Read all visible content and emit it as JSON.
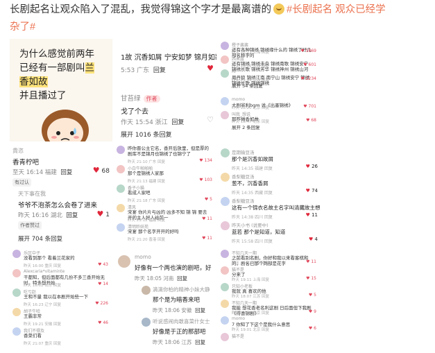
{
  "post": {
    "text_before": "长剧起名让观众陷入了混乱，我觉得锦这个字才是最离谱的",
    "tag1": "#长剧起名 观众已经学",
    "tag2": "杂了#",
    "emoji": "doge-emoji"
  },
  "cell1": {
    "line1": "为什么感觉前两年",
    "line2": "已经有一部剧叫",
    "line2_hl": "兰",
    "line3": "香如故",
    "line4": "并且播过了"
  },
  "cell2": {
    "titles": "1故 沉香如屑 宁安如梦 锦月如歌",
    "time1": "5:53 广东",
    "reply1": "回复",
    "user": "甘苔绿",
    "badge": "作者",
    "comment": "戈了个去",
    "meta": "作天 15:54 浙江",
    "reply2": "回复",
    "expand": "展开 1016 条回复"
  },
  "cell3": {
    "rows": [
      {
        "name": "橙子酱酱",
        "text": "还有各种锦绣 锦绣缘什么的 锦绣了好几部名称字的",
        "meta": "昨天 17:23 上海 回复",
        "likes": "1869"
      },
      {
        "name": "西米露",
        "text": "还有锦绣 锦绣未央 锦绣南歌 锦绣安宁 锦绣长歌 锦绣芳华 锦绣神州 锦绣山河",
        "meta": "昨天 18:02 江苏 回复",
        "likes": "601"
      },
      {
        "name": "Rr",
        "text": "周丹狼 锦绣江南 南宁山 锦绣安宁 锦绣 锦绣长歌 锦绣锦绣",
        "meta": "昨天 21:44 江苏 回复",
        "likes": "2234"
      },
      {
        "name": "",
        "text": "展开 54 条回复",
        "meta": "",
        "likes": ""
      },
      {
        "name": "momo",
        "text": "大剧爷利bgm 说《出墨锦绣》",
        "meta": "昨天 18:20 北京 回复",
        "likes": "701"
      },
      {
        "name": "叫我_想说",
        "text": "那咋摊香如故",
        "meta": "昨天 18:47 北京 回复",
        "likes": "68"
      },
      {
        "name": "",
        "text": "展开 2 条回复",
        "meta": "",
        "likes": ""
      }
    ]
  },
  "cell4": {
    "user1": "貴恣",
    "comment1": "香青柠吧",
    "meta1": "至天 16:14 福建",
    "reply1": "回复",
    "likes1": "68",
    "chip1": "有过认",
    "user2": "天下事在我",
    "comment2": "爷爷不泡茶怎么会卷了进来",
    "meta2": "昨天 16:16 湖北",
    "reply2": "回复",
    "likes2": "1",
    "chip2": "作者赞过",
    "expand": "展开 704 条回复"
  },
  "cell5": {
    "rows": [
      {
        "name": "",
        "text": "昨你晋公主它名，香开后放里，但是厚的剧库不是锦月也锦绣了也锦宁了",
        "meta": "昨天 21:10 广东 回复",
        "likes": "134"
      },
      {
        "name": "小白牛啪啪啪",
        "text": "那个是锦绣人家那",
        "meta": "昨天 21:13 福建 回复",
        "likes": "103"
      },
      {
        "name": "香子小猫",
        "text": "看成人家吧",
        "meta": "昨天 21:18 广东 回复",
        "likes": "5"
      },
      {
        "name": "清风",
        "text": "宋宴 你片片与凶的 凶多不知 锦 锦 要去开的主人好人给前一",
        "meta": "昨天 21:12 福建 回复",
        "likes": "11"
      },
      {
        "name": "清明聆妖苑",
        "text": "宋宴 那个名字开开的好吗",
        "meta": "昨天 21:20 香港 回复",
        "likes": "11"
      }
    ]
  },
  "cell6": {
    "rows": [
      {
        "name": "是期输豆汤",
        "text": "那个是沉香如故屑",
        "meta": "昨天 14:35 福建 回复",
        "likes": "26"
      },
      {
        "name": "香梨糖豆汤",
        "text": "葱不，沉香香屑",
        "meta": "昨天 14:35 西藏 回复",
        "likes": "74"
      },
      {
        "name": "香梨糖豆汤",
        "text": "这有一个锦衣名故主名字叫清藏故主想是名字",
        "meta": "昨天 14:38 四川 回复",
        "likes": "11"
      },
      {
        "name": "昨天小书 (说要中)",
        "text": "蓝若 那个是知道，知道",
        "meta": "昨天 15:58 四川 回复",
        "likes": "4"
      }
    ]
  },
  "cell7": {
    "rows": [
      {
        "name": "乐区中子",
        "text": "没看到那个 看着兰花家的",
        "meta": "昨天 16:00 重庆 回复",
        "likes": "43"
      },
      {
        "name": "Alexcaria*vitaminte",
        "text": "干都知，但后面都有几份不多三香开始无时，特多想开始",
        "meta": "昨天 16:02 山东 回复",
        "likes": "14"
      },
      {
        "name": "吃亏赵",
        "text": "王和不量 我以在本剧开始些一下",
        "meta": "昨天 16:23 辽宁 回复",
        "likes": "226"
      },
      {
        "name": "胡子牛哈",
        "text": "王霸非常",
        "meta": "昨天 19:21 安徽 回复",
        "likes": "46"
      },
      {
        "name": "我们不得及",
        "text": "香菜们看",
        "meta": "昨天 21:07 重庆 回复",
        "likes": ""
      }
    ]
  },
  "cell8": {
    "user1": "momo",
    "comment1": "好像有一个两也演的剧吧，好",
    "meta1": "昨天 18:05 河南",
    "reply1": "回复",
    "user2": "滴滴你柏的精神小妹大静",
    "comment2": "那个是为暗香来吧",
    "meta2": "昨天 18:06 安徽",
    "reply2": "回复",
    "user3": "听说感闹肉敢喜菜什女士",
    "comment3": "好像是于正的那部吧",
    "meta3": "昨天 18:06 江苏",
    "reply3": "回复"
  },
  "cell9": {
    "rows": [
      {
        "name": "不知几天一期",
        "text": "之前看别名剧，你好和我以来看客棋和的，剧名已那个两部是花字",
        "meta": "昨天 17:52 北京 回复",
        "likes": "11"
      },
      {
        "name": "猫不是",
        "text": "分来了",
        "meta": "昨天 19:11 上海 回复",
        "likes": "15"
      },
      {
        "name": "只知小老板",
        "text": "我就 真 喜欢的他",
        "meta": "昨天 18:07 江苏 回复",
        "likes": "5"
      },
      {
        "name": "不知几天一期",
        "text": "我能 想花香老名利这剧 日后面但下我剧《得喜锦剧》",
        "meta": "昨天 18:59 北京 回复",
        "likes": "9"
      },
      {
        "name": "momo",
        "text": "7 你知了下这个是我什么意思",
        "meta": "昨天 19:01 北京 回复",
        "likes": "6"
      },
      {
        "name": "猫不是",
        "text": "",
        "meta": "",
        "likes": ""
      }
    ]
  },
  "colors": {
    "accent": "#eb7350",
    "like": "#e0263a",
    "highlight": "#fde27a"
  }
}
